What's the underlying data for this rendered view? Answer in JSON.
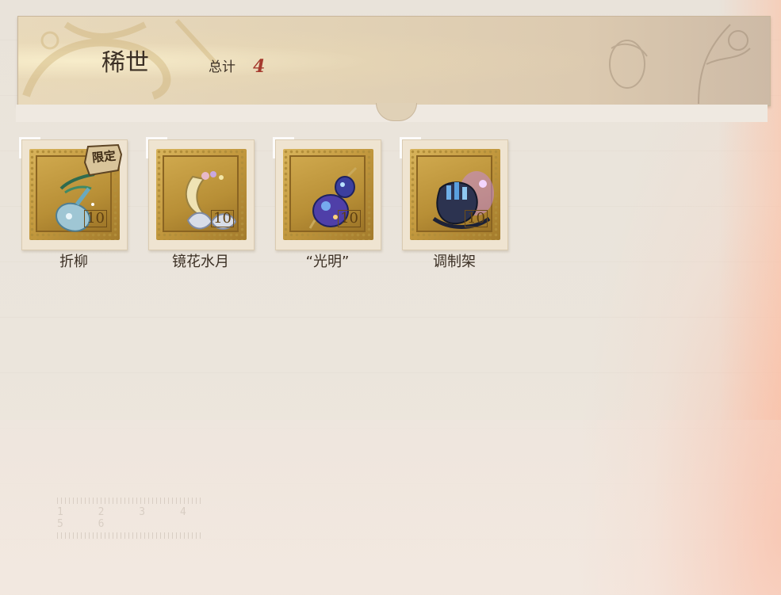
{
  "header": {
    "title": "稀世",
    "total_label": "总计",
    "total_count": "4"
  },
  "items": [
    {
      "name": "折柳",
      "stamp_value": "10",
      "badge": "限定",
      "icon": "willow-vase-icon"
    },
    {
      "name": "镜花水月",
      "stamp_value": "10",
      "badge": "",
      "icon": "crescent-moon-flower-icon"
    },
    {
      "name": "“光明”",
      "stamp_value": "10",
      "badge": "",
      "icon": "gourd-lantern-icon"
    },
    {
      "name": "调制架",
      "stamp_value": "10",
      "badge": "",
      "icon": "mixing-rack-icon"
    }
  ],
  "ruler": {
    "numbers": "1 2 3 4 5 6"
  },
  "colors": {
    "count_red": "#a53a2e",
    "text_dark": "#3b2f24",
    "stamp_gold": "#c49a3f"
  }
}
